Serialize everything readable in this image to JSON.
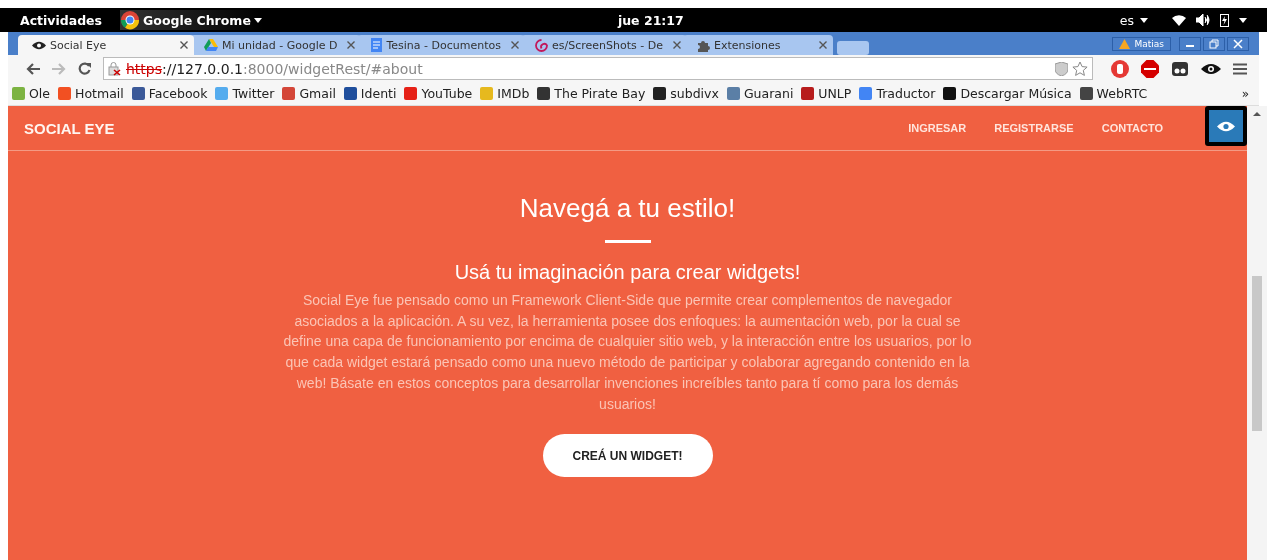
{
  "system_bar": {
    "activities": "Actividades",
    "app": "Google Chrome",
    "clock": "jue 21:17",
    "language": "es"
  },
  "tabs": [
    {
      "title": "Social Eye",
      "selected": true,
      "kind": "eye"
    },
    {
      "title": "Mi unidad - Google D",
      "selected": false,
      "kind": "drive"
    },
    {
      "title": "Tesina - Documentos",
      "selected": false,
      "kind": "doc"
    },
    {
      "title": "es/ScreenShots - De",
      "selected": false,
      "kind": "swirl"
    },
    {
      "title": "Extensiones",
      "selected": false,
      "kind": "puzzle"
    }
  ],
  "profile": {
    "name": "Matias"
  },
  "address_bar": {
    "scheme": "https",
    "rest_host": "://127.0.0.1",
    "rest_path": ":8000/widgetRest/#about"
  },
  "bookmarks": [
    {
      "label": "Ole",
      "color": "#7cb342"
    },
    {
      "label": "Hotmail",
      "color": "#f25022"
    },
    {
      "label": "Facebook",
      "color": "#3b5998"
    },
    {
      "label": "Twitter",
      "color": "#55acee"
    },
    {
      "label": "Gmail",
      "color": "#d44638"
    },
    {
      "label": "Identi",
      "color": "#1f4e9c"
    },
    {
      "label": "YouTube",
      "color": "#e62117"
    },
    {
      "label": "IMDb",
      "color": "#e6b91e"
    },
    {
      "label": "The Pirate Bay",
      "color": "#333333"
    },
    {
      "label": "subdivx",
      "color": "#222222"
    },
    {
      "label": "Guarani",
      "color": "#5b7fa6"
    },
    {
      "label": "UNLP",
      "color": "#b71c1c"
    },
    {
      "label": "Traductor",
      "color": "#4285f4"
    },
    {
      "label": "Descargar Música",
      "color": "#111111"
    },
    {
      "label": "WebRTC",
      "color": "#444444"
    }
  ],
  "bookmarks_more": "»",
  "site": {
    "brand": "SOCIAL EYE",
    "nav": [
      "INGRESAR",
      "REGISTRARSE",
      "CONTACTO"
    ],
    "title": "Navegá a tu estilo!",
    "subtitle": "Usá tu imaginación para crear widgets!",
    "text": "Social Eye fue pensado como un Framework Client-Side que permite crear complementos de navegador asociados a la aplicación. A su vez, la herramienta posee dos enfoques: la aumentación web, por la cual se define una capa de funcionamiento por encima de cualquier sitio web, y la interacción entre los usuarios, por lo que cada widget estará pensado como una nuevo método de participar y colaborar agregando contenido en la web! Básate en estos conceptos para desarrollar invenciones increíbles tanto para tí como para los demás usuarios!",
    "button": "CREÁ UN WIDGET!"
  }
}
